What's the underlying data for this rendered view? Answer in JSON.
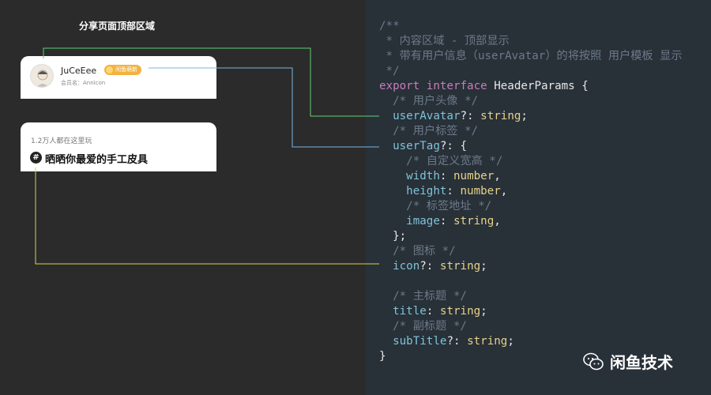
{
  "section_title": "分享页面顶部区域",
  "user_card": {
    "username": "JuCeEee",
    "tag": "闲鱼萌新",
    "member": "会员名：Annicon"
  },
  "title_card": {
    "subtitle": "1.2万人都在这里玩",
    "hash": "#",
    "title": "晒晒你最爱的手工皮具"
  },
  "code": {
    "line1": "/**",
    "line2": " * 内容区域 - 顶部显示",
    "line3": " * 带有用户信息（userAvatar）的将按照 用户模板 显示",
    "line4": " */",
    "kw_export": "export",
    "kw_interface": "interface",
    "iface_name": "HeaderParams {",
    "c_avatar": "/* 用户头像 */",
    "p_avatar": "userAvatar",
    "opt_colon": "?:",
    "colon": ":",
    "t_string": "string",
    "t_number": "number",
    "semi": ";",
    "comma": ",",
    "c_tag": "/* 用户标签 */",
    "p_tag": "userTag",
    "brace_open": " {",
    "c_size": "/* 自定义宽高 */",
    "p_width": "width",
    "p_height": "height",
    "c_addr": "/* 标签地址 */",
    "p_image": "image",
    "close_semi": "};",
    "c_icon": "/* 图标 */",
    "p_icon": "icon",
    "c_title": "/* 主标题 */",
    "p_title": "title",
    "c_sub": "/* 副标题 */",
    "p_sub": "subTitle",
    "close": "}"
  },
  "watermark": {
    "text": "闲鱼技术",
    "icon": "wechat-icon"
  },
  "colors": {
    "green_line": "#5fcf72",
    "blue_line": "#7ab6de",
    "yellow_line": "#d8d24a",
    "tag_bg": "#f3b23f"
  }
}
